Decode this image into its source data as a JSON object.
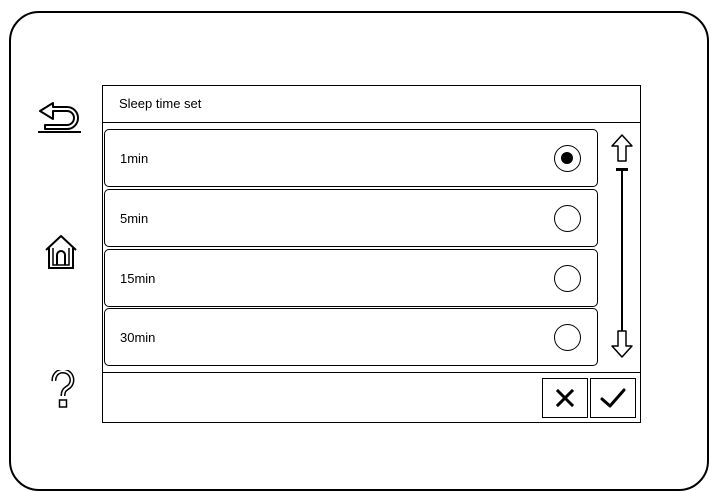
{
  "screen": {
    "title": "Sleep time set"
  },
  "options": [
    {
      "label": "1min",
      "selected": true
    },
    {
      "label": "5min",
      "selected": false
    },
    {
      "label": "15min",
      "selected": false
    },
    {
      "label": "30min",
      "selected": false
    }
  ],
  "side_nav": {
    "icons": [
      "back-icon",
      "home-icon",
      "help-icon"
    ]
  },
  "scroll": {
    "icons": [
      "scroll-up-arrow-icon",
      "scroll-down-arrow-icon"
    ]
  },
  "actions": {
    "icons": [
      "cancel-x-icon",
      "confirm-check-icon"
    ]
  }
}
